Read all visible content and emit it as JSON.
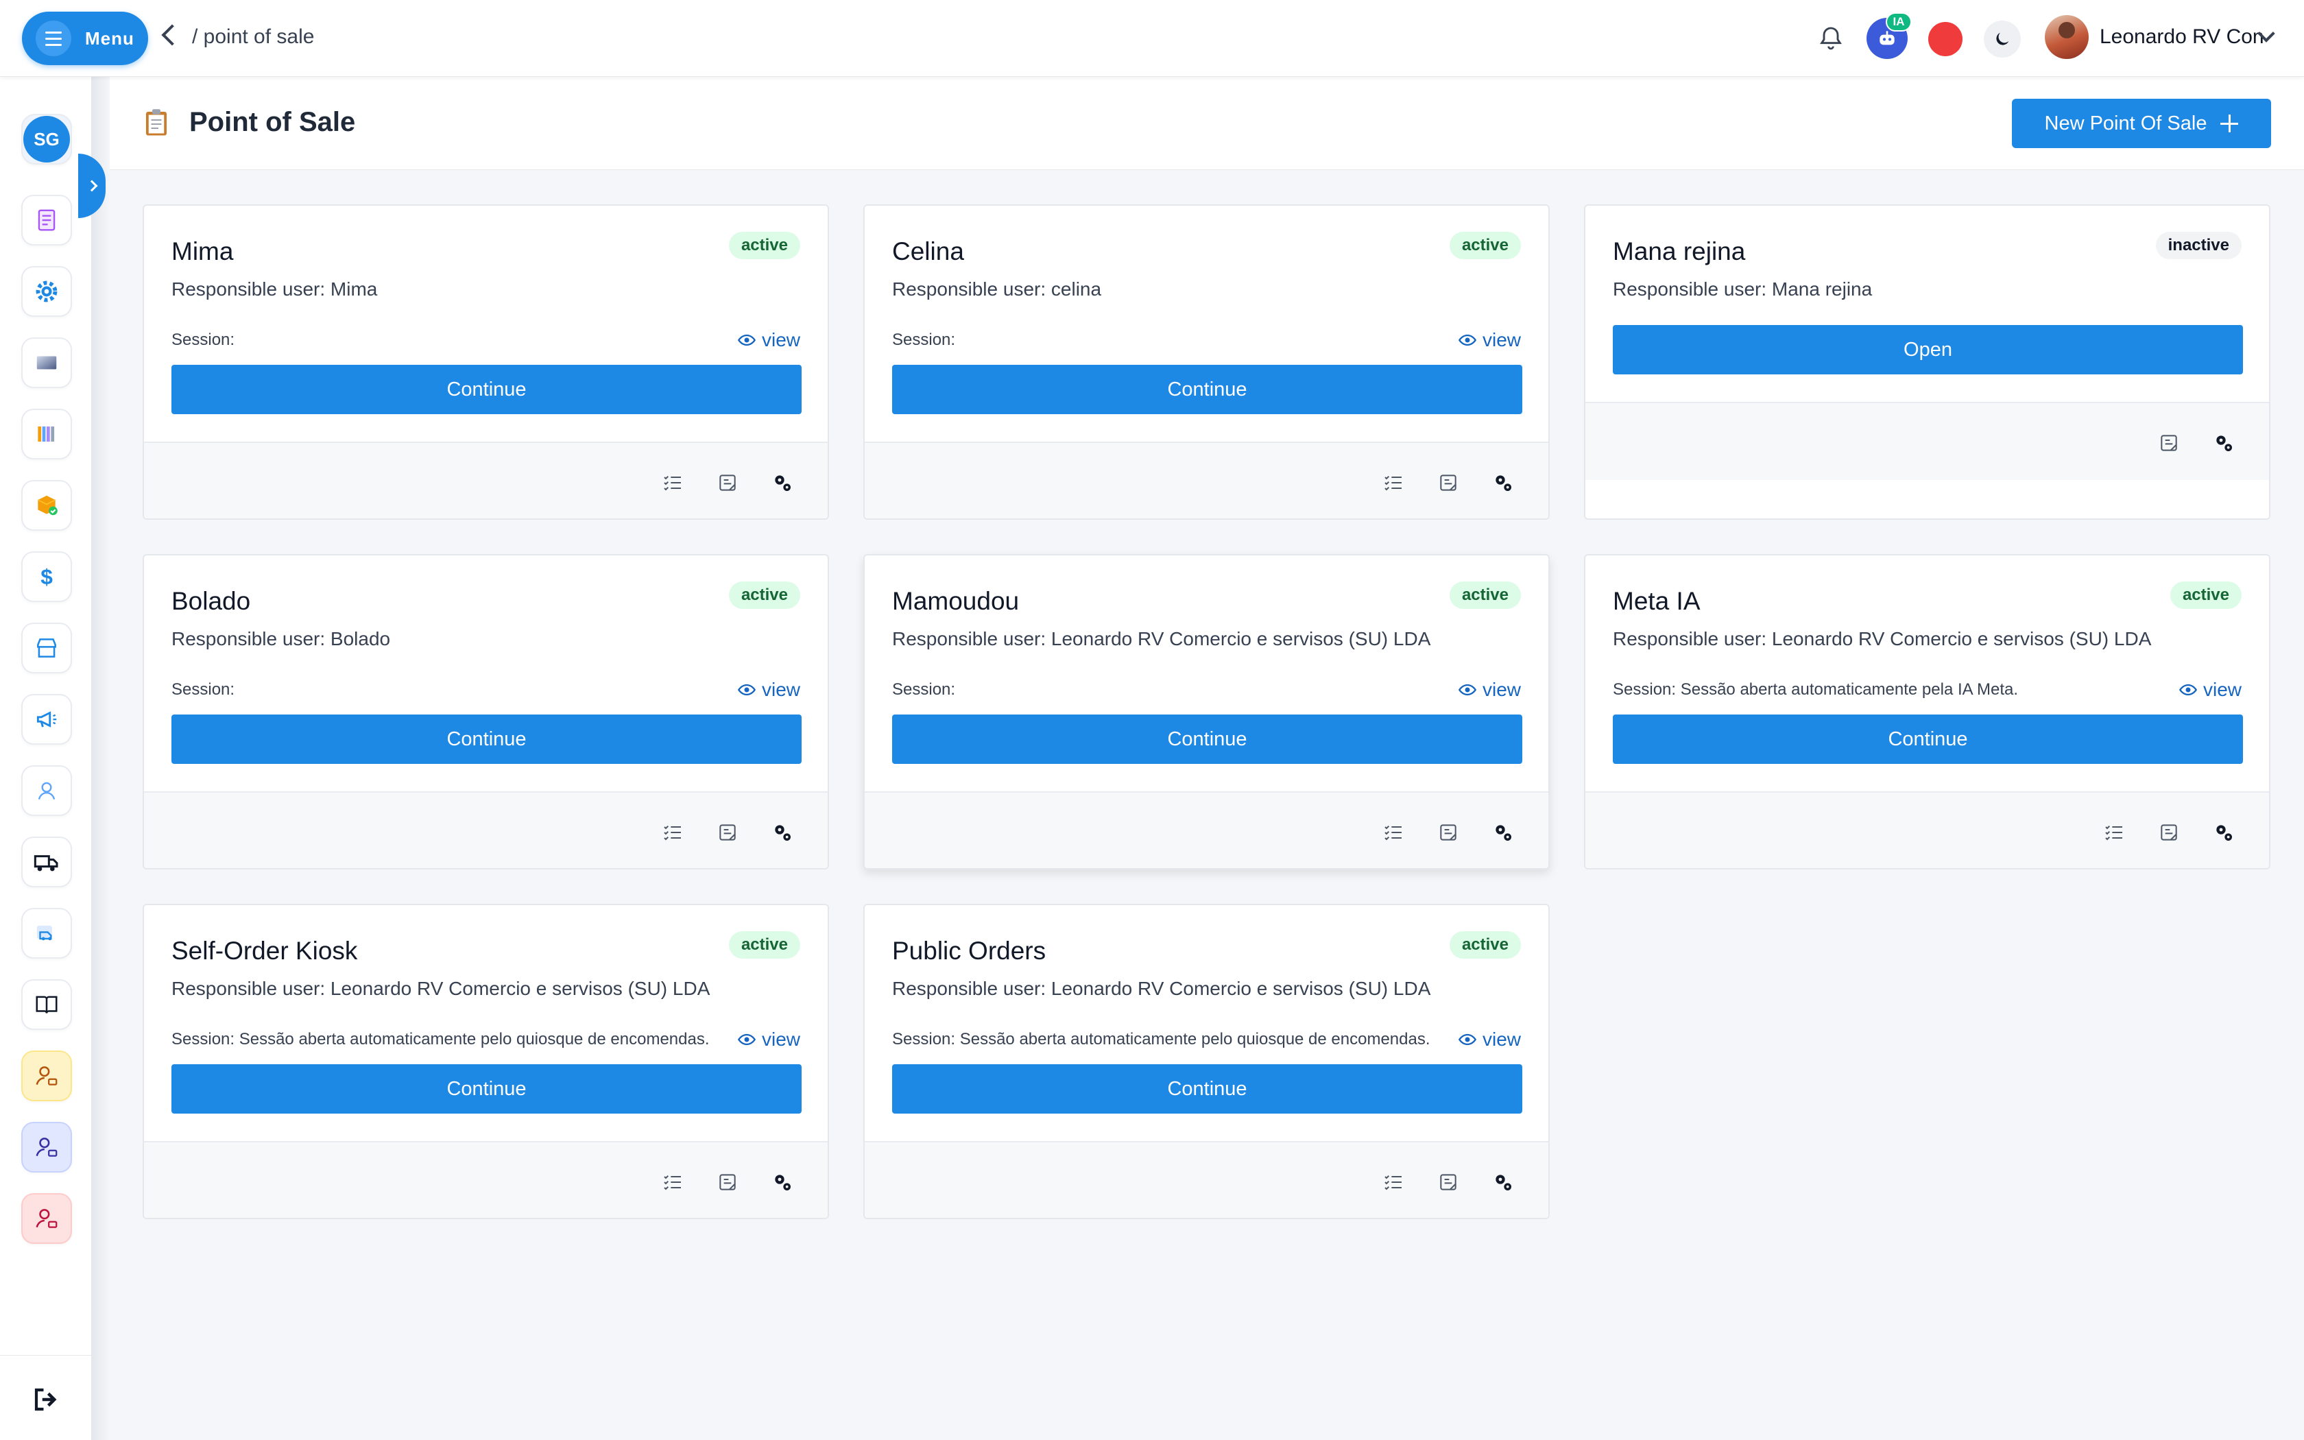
{
  "topbar": {
    "menu_label": "Menu",
    "breadcrumb": "/ point of sale",
    "ai_badge": "IA",
    "user_name": "Leonardo RV Con"
  },
  "sidebar": {
    "avatar_initials": "SG",
    "items": [
      {
        "icon": "receipt-icon"
      },
      {
        "icon": "settings-gear-icon"
      },
      {
        "icon": "gradient-image-icon"
      },
      {
        "icon": "books-icon"
      },
      {
        "icon": "package-check-icon"
      },
      {
        "icon": "dollar-icon"
      },
      {
        "icon": "store-icon"
      },
      {
        "icon": "megaphone-icon"
      },
      {
        "icon": "users-settings-icon"
      },
      {
        "icon": "delivery-truck-icon"
      },
      {
        "icon": "shipping-icon"
      },
      {
        "icon": "open-book-icon"
      },
      {
        "icon": "user-yellow-icon"
      },
      {
        "icon": "user-blue-icon"
      },
      {
        "icon": "user-red-icon"
      }
    ],
    "logout_icon": "logout-icon"
  },
  "page": {
    "title": "Point of Sale",
    "new_button": "New Point Of Sale"
  },
  "colors": {
    "primary": "#1e88e5",
    "active_bg": "#dcfce7",
    "active_text": "#166534",
    "record": "#ef3b3b"
  },
  "cards": [
    {
      "name": "Mima",
      "status": "active",
      "responsible": "Responsible user: Mima",
      "session": "Session:",
      "view": "view",
      "action": "Continue"
    },
    {
      "name": "Celina",
      "status": "active",
      "responsible": "Responsible user: celina",
      "session": "Session:",
      "view": "view",
      "action": "Continue"
    },
    {
      "name": "Mana rejina",
      "status": "inactive",
      "responsible": "Responsible user: Mana rejina",
      "action": "Open"
    },
    {
      "name": "Bolado",
      "status": "active",
      "responsible": "Responsible user: Bolado",
      "session": "Session:",
      "view": "view",
      "action": "Continue"
    },
    {
      "name": "Mamoudou",
      "status": "active",
      "responsible": "Responsible user: Leonardo RV Comercio e servisos (SU) LDA",
      "session": "Session:",
      "view": "view",
      "action": "Continue"
    },
    {
      "name": "Meta IA",
      "status": "active",
      "responsible": "Responsible user: Leonardo RV Comercio e servisos (SU) LDA",
      "session": "Session: Sessão aberta automaticamente pela IA Meta.",
      "view": "view",
      "action": "Continue"
    },
    {
      "name": "Self-Order Kiosk",
      "status": "active",
      "responsible": "Responsible user: Leonardo RV Comercio e servisos (SU) LDA",
      "session": "Session: Sessão aberta automaticamente pelo quiosque de encomendas.",
      "view": "view",
      "action": "Continue"
    },
    {
      "name": "Public Orders",
      "status": "active",
      "responsible": "Responsible user: Leonardo RV Comercio e servisos (SU) LDA",
      "session": "Session: Sessão aberta automaticamente pelo quiosque de encomendas.",
      "view": "view",
      "action": "Continue"
    }
  ]
}
